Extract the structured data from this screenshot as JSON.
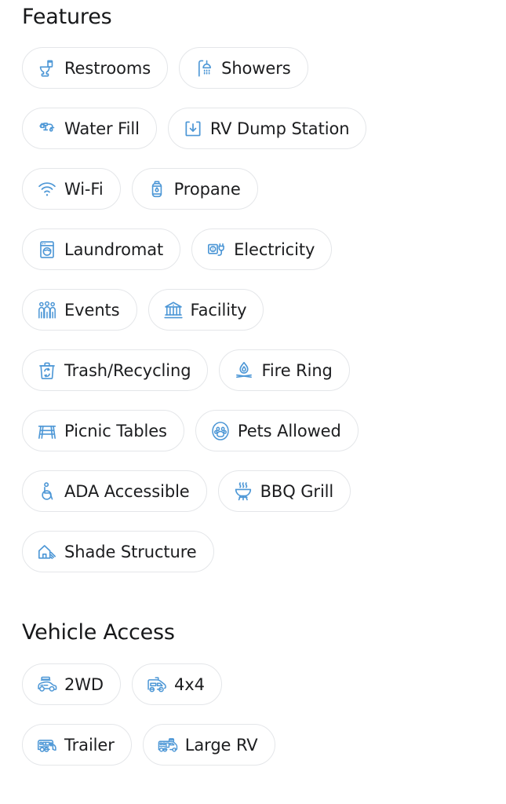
{
  "theme": {
    "background": "#ffffff",
    "icon_color": "#4d97d6",
    "chip_border": "#e4e6e9",
    "heading_color": "#17181a",
    "label_color": "#1c1d1f"
  },
  "features": {
    "heading": "Features",
    "chips": [
      {
        "label": "Restrooms",
        "icon": "toilet-icon"
      },
      {
        "label": "Showers",
        "icon": "shower-icon"
      },
      {
        "label": "Water Fill",
        "icon": "faucet-icon"
      },
      {
        "label": "RV Dump Station",
        "icon": "download-tray-icon"
      },
      {
        "label": "Wi-Fi",
        "icon": "wifi-icon"
      },
      {
        "label": "Propane",
        "icon": "propane-tank-icon"
      },
      {
        "label": "Laundromat",
        "icon": "washing-machine-icon"
      },
      {
        "label": "Electricity",
        "icon": "outlet-plug-icon"
      },
      {
        "label": "Events",
        "icon": "people-group-icon"
      },
      {
        "label": "Facility",
        "icon": "bank-building-icon"
      },
      {
        "label": "Trash/Recycling",
        "icon": "recycling-bin-icon"
      },
      {
        "label": "Fire Ring",
        "icon": "campfire-icon"
      },
      {
        "label": "Picnic Tables",
        "icon": "picnic-table-icon"
      },
      {
        "label": "Pets Allowed",
        "icon": "paw-print-icon"
      },
      {
        "label": "ADA Accessible",
        "icon": "wheelchair-icon"
      },
      {
        "label": "BBQ Grill",
        "icon": "bbq-grill-icon"
      },
      {
        "label": "Shade Structure",
        "icon": "shade-canopy-icon"
      }
    ]
  },
  "vehicle_access": {
    "heading": "Vehicle Access",
    "chips": [
      {
        "label": "2WD",
        "icon": "suv-icon"
      },
      {
        "label": "4x4",
        "icon": "van-icon"
      },
      {
        "label": "Trailer",
        "icon": "travel-trailer-icon"
      },
      {
        "label": "Large RV",
        "icon": "motorhome-icon"
      }
    ]
  }
}
